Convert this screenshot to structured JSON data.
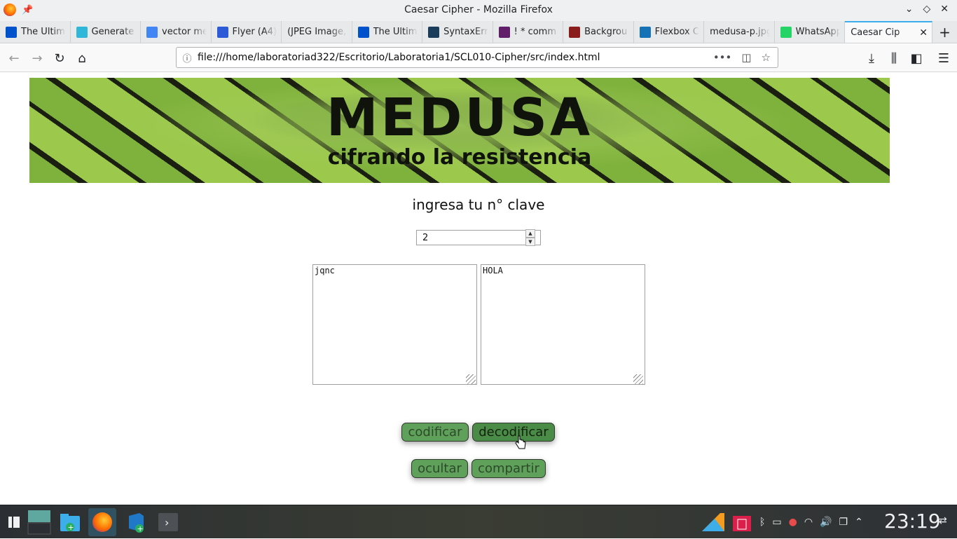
{
  "window": {
    "title": "Caesar Cipher - Mozilla Firefox"
  },
  "tabs": [
    {
      "label": "The Ultim",
      "icon": "atlassian-icon",
      "color": "#0052cc"
    },
    {
      "label": "Generate",
      "icon": "generate-icon",
      "color": "#2fb7d9"
    },
    {
      "label": "vector me",
      "icon": "google-icon",
      "color": "#4285f4"
    },
    {
      "label": "Flyer (A4)",
      "icon": "canva-icon",
      "color": "#2d5bd7"
    },
    {
      "label": "(JPEG Image,",
      "icon": "",
      "color": ""
    },
    {
      "label": "The Ultim",
      "icon": "atlassian-icon",
      "color": "#0052cc"
    },
    {
      "label": "SyntaxErr",
      "icon": "syntax-icon",
      "color": "#1a3d5c"
    },
    {
      "label": "! * comm",
      "icon": "slack-icon",
      "color": "#611f69"
    },
    {
      "label": "Backgrou",
      "icon": "w3c-icon",
      "color": "#8b1c1c"
    },
    {
      "label": "Flexbox C",
      "icon": "css-icon",
      "color": "#1572b6"
    },
    {
      "label": "medusa-p.jpg",
      "icon": "",
      "color": ""
    },
    {
      "label": "WhatsApp",
      "icon": "whatsapp-icon",
      "color": "#25d366"
    },
    {
      "label": "Caesar Cip",
      "icon": "",
      "color": "",
      "active": true
    }
  ],
  "nav": {
    "url": "file:///home/laboratoriad322/Escritorio/Laboratoria1/SCL010-Cipher/src/index.html"
  },
  "page": {
    "banner_title": "MEDUSA",
    "banner_subtitle": "cifrando la resistencia",
    "prompt": "ingresa tu n° clave",
    "key_value": "2",
    "input_text": "jqnc",
    "output_text": "HOLA",
    "buttons": {
      "encode": "codificar",
      "decode": "decodificar",
      "hide": "ocultar",
      "share": "compartir"
    }
  },
  "taskbar": {
    "clock": "23:19"
  }
}
